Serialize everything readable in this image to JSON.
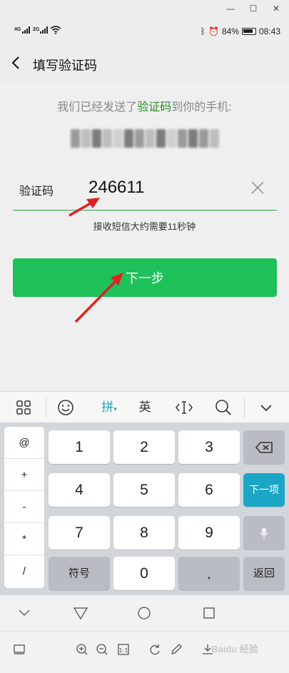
{
  "status_bar": {
    "network_1": "4G",
    "network_2": "2G",
    "battery": "84%",
    "time": "08:43"
  },
  "nav": {
    "title": "填写验证码"
  },
  "intro": {
    "prefix": "我们已经发送了",
    "highlight": "验证码",
    "suffix": "到你的手机:"
  },
  "form": {
    "code_label": "验证码",
    "code_value": "246611",
    "hint": "接收短信大约需要11秒钟"
  },
  "next_button": {
    "label": "下一步"
  },
  "keyboard_toolbar": {
    "pinyin": "拼",
    "english": "英"
  },
  "keyboard": {
    "symbols": [
      "@",
      "+",
      "-",
      "*",
      "/"
    ],
    "rows": [
      [
        "1",
        "2",
        "3"
      ],
      [
        "4",
        "5",
        "6"
      ],
      [
        "7",
        "8",
        "9"
      ]
    ],
    "symbol_key": "符号",
    "zero": "0",
    "dot": ".",
    "next_field": "下一项",
    "return": "返回"
  },
  "watermark": "Baidu 经验",
  "colors": {
    "primary_green": "#1ec05a",
    "highlight_green": "#2a8a2a",
    "next_field_blue": "#1ba6c6",
    "arrow_red": "#e02020"
  }
}
